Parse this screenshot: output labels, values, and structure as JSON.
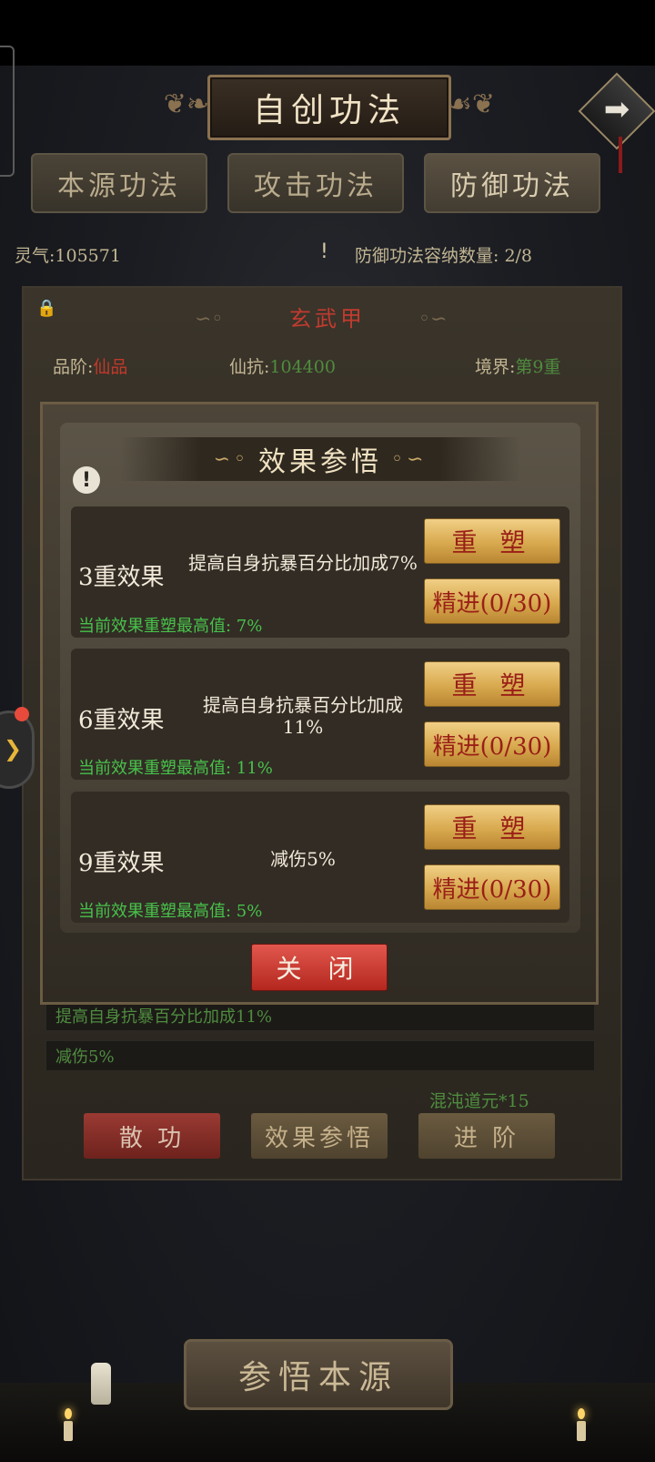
{
  "header": {
    "title": "自创功法",
    "next_icon": "arrow-right-icon"
  },
  "tabs": [
    {
      "label": "本源功法"
    },
    {
      "label": "攻击功法"
    },
    {
      "label": "防御功法",
      "active": true
    }
  ],
  "info_bar": {
    "lingqi_label": "灵气:",
    "lingqi_value": "105571",
    "warn_icon": "!",
    "capacity_text": "防御功法容纳数量: 2/8"
  },
  "ability": {
    "name": "玄武甲",
    "grade_label": "品阶:",
    "grade_value": "仙品",
    "resist_label": "仙抗:",
    "resist_value": "104400",
    "realm_label": "境界:",
    "realm_value": "第9重",
    "effect_lines": [
      "提高自身抗暴百分比加成11%",
      "减伤5%"
    ],
    "cost_text": "混沌道元*15",
    "buttons": {
      "disperse": "散 功",
      "comprehend": "效果参悟",
      "advance": "进 阶"
    }
  },
  "modal": {
    "title": "效果参悟",
    "warn_icon": "!",
    "effects": [
      {
        "name": "3重效果",
        "desc": "提高自身抗暴百分比加成7%",
        "max_text": "当前效果重塑最高值: 7%",
        "reshape_label": "重 塑",
        "refine_label": "精进(0/30)"
      },
      {
        "name": "6重效果",
        "desc": "提高自身抗暴百分比加成11%",
        "max_text": "当前效果重塑最高值: 11%",
        "reshape_label": "重 塑",
        "refine_label": "精进(0/30)"
      },
      {
        "name": "9重效果",
        "desc": "减伤5%",
        "max_text": "当前效果重塑最高值: 5%",
        "reshape_label": "重 塑",
        "refine_label": "精进(0/30)"
      }
    ],
    "close_label": "关 闭"
  },
  "bottom": {
    "main_button": "参悟本源"
  },
  "colors": {
    "accent_red": "#c0392b",
    "accent_green": "#48c24a",
    "gold_button": "#d8a94e"
  }
}
